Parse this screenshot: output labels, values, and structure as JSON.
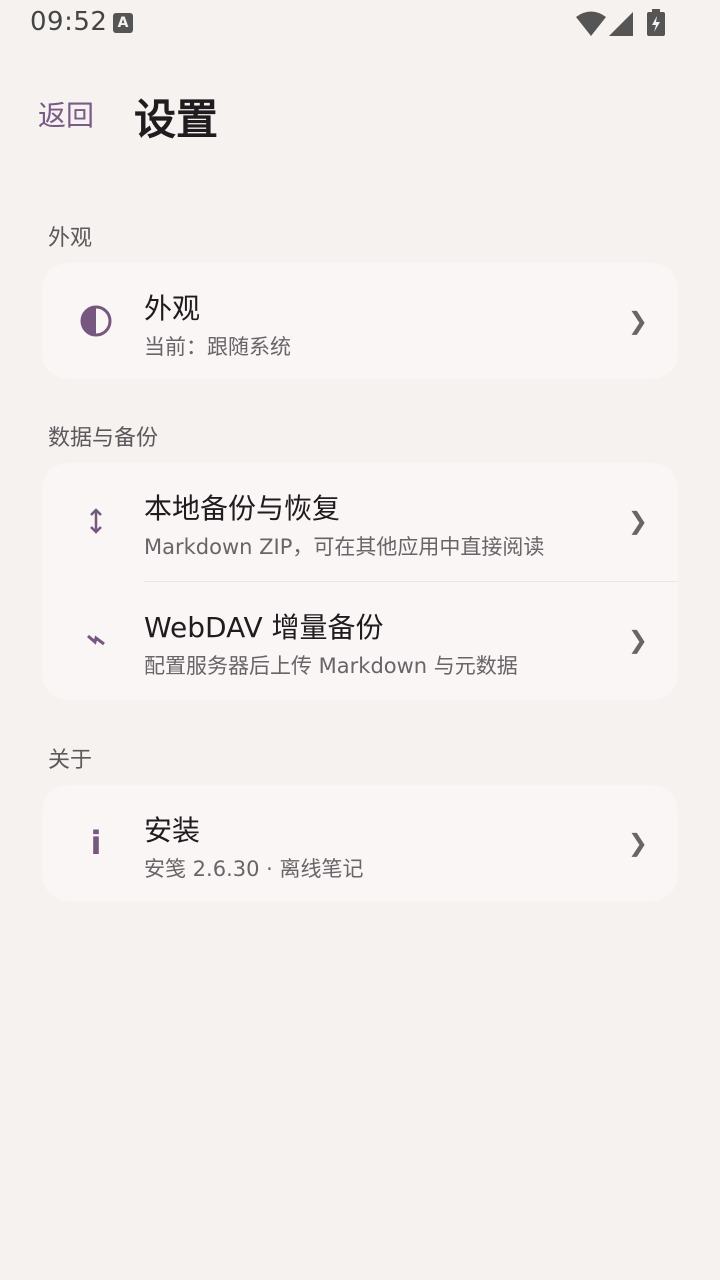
{
  "status_bar": {
    "time": "09:52",
    "notification_icon": "A"
  },
  "header": {
    "back_label": "返回",
    "title": "设置"
  },
  "sections": [
    {
      "label": "外观",
      "items": [
        {
          "title": "外观",
          "subtitle": "当前：跟随系统",
          "icon": "contrast-icon"
        }
      ]
    },
    {
      "label": "数据与备份",
      "items": [
        {
          "title": "本地备份与恢复",
          "subtitle": "Markdown ZIP，可在其他应用中直接阅读",
          "icon": "up-down-arrow-icon"
        },
        {
          "title": "WebDAV 增量备份",
          "subtitle": "配置服务器后上传 Markdown 与元数据",
          "icon": "lightning-icon"
        }
      ]
    },
    {
      "label": "关于",
      "items": [
        {
          "title": "安装",
          "subtitle": "安笺 2.6.30 · 离线笔记",
          "icon": "info-icon"
        }
      ]
    }
  ],
  "colors": {
    "accent": "#76577f",
    "background": "#f5f2ef",
    "card": "#f9f6f5"
  }
}
